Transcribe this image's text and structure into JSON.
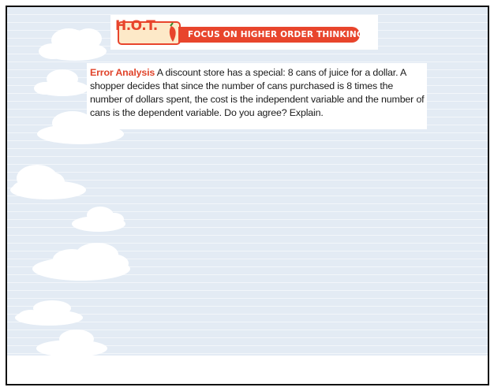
{
  "banner": {
    "logo_text": "H.O.T.",
    "title": "FOCUS ON HIGHER ORDER THINKING"
  },
  "problem": {
    "label": "Error Analysis",
    "text": " A discount store has a special: 8 cans of juice for a dollar. A shopper decides that since the number of cans purchased is 8 times the number of dollars spent, the cost is the independent variable and the number of cans is the dependent variable. Do you agree? Explain."
  },
  "colors": {
    "accent": "#e8452c",
    "background": "#e3ebf4"
  }
}
